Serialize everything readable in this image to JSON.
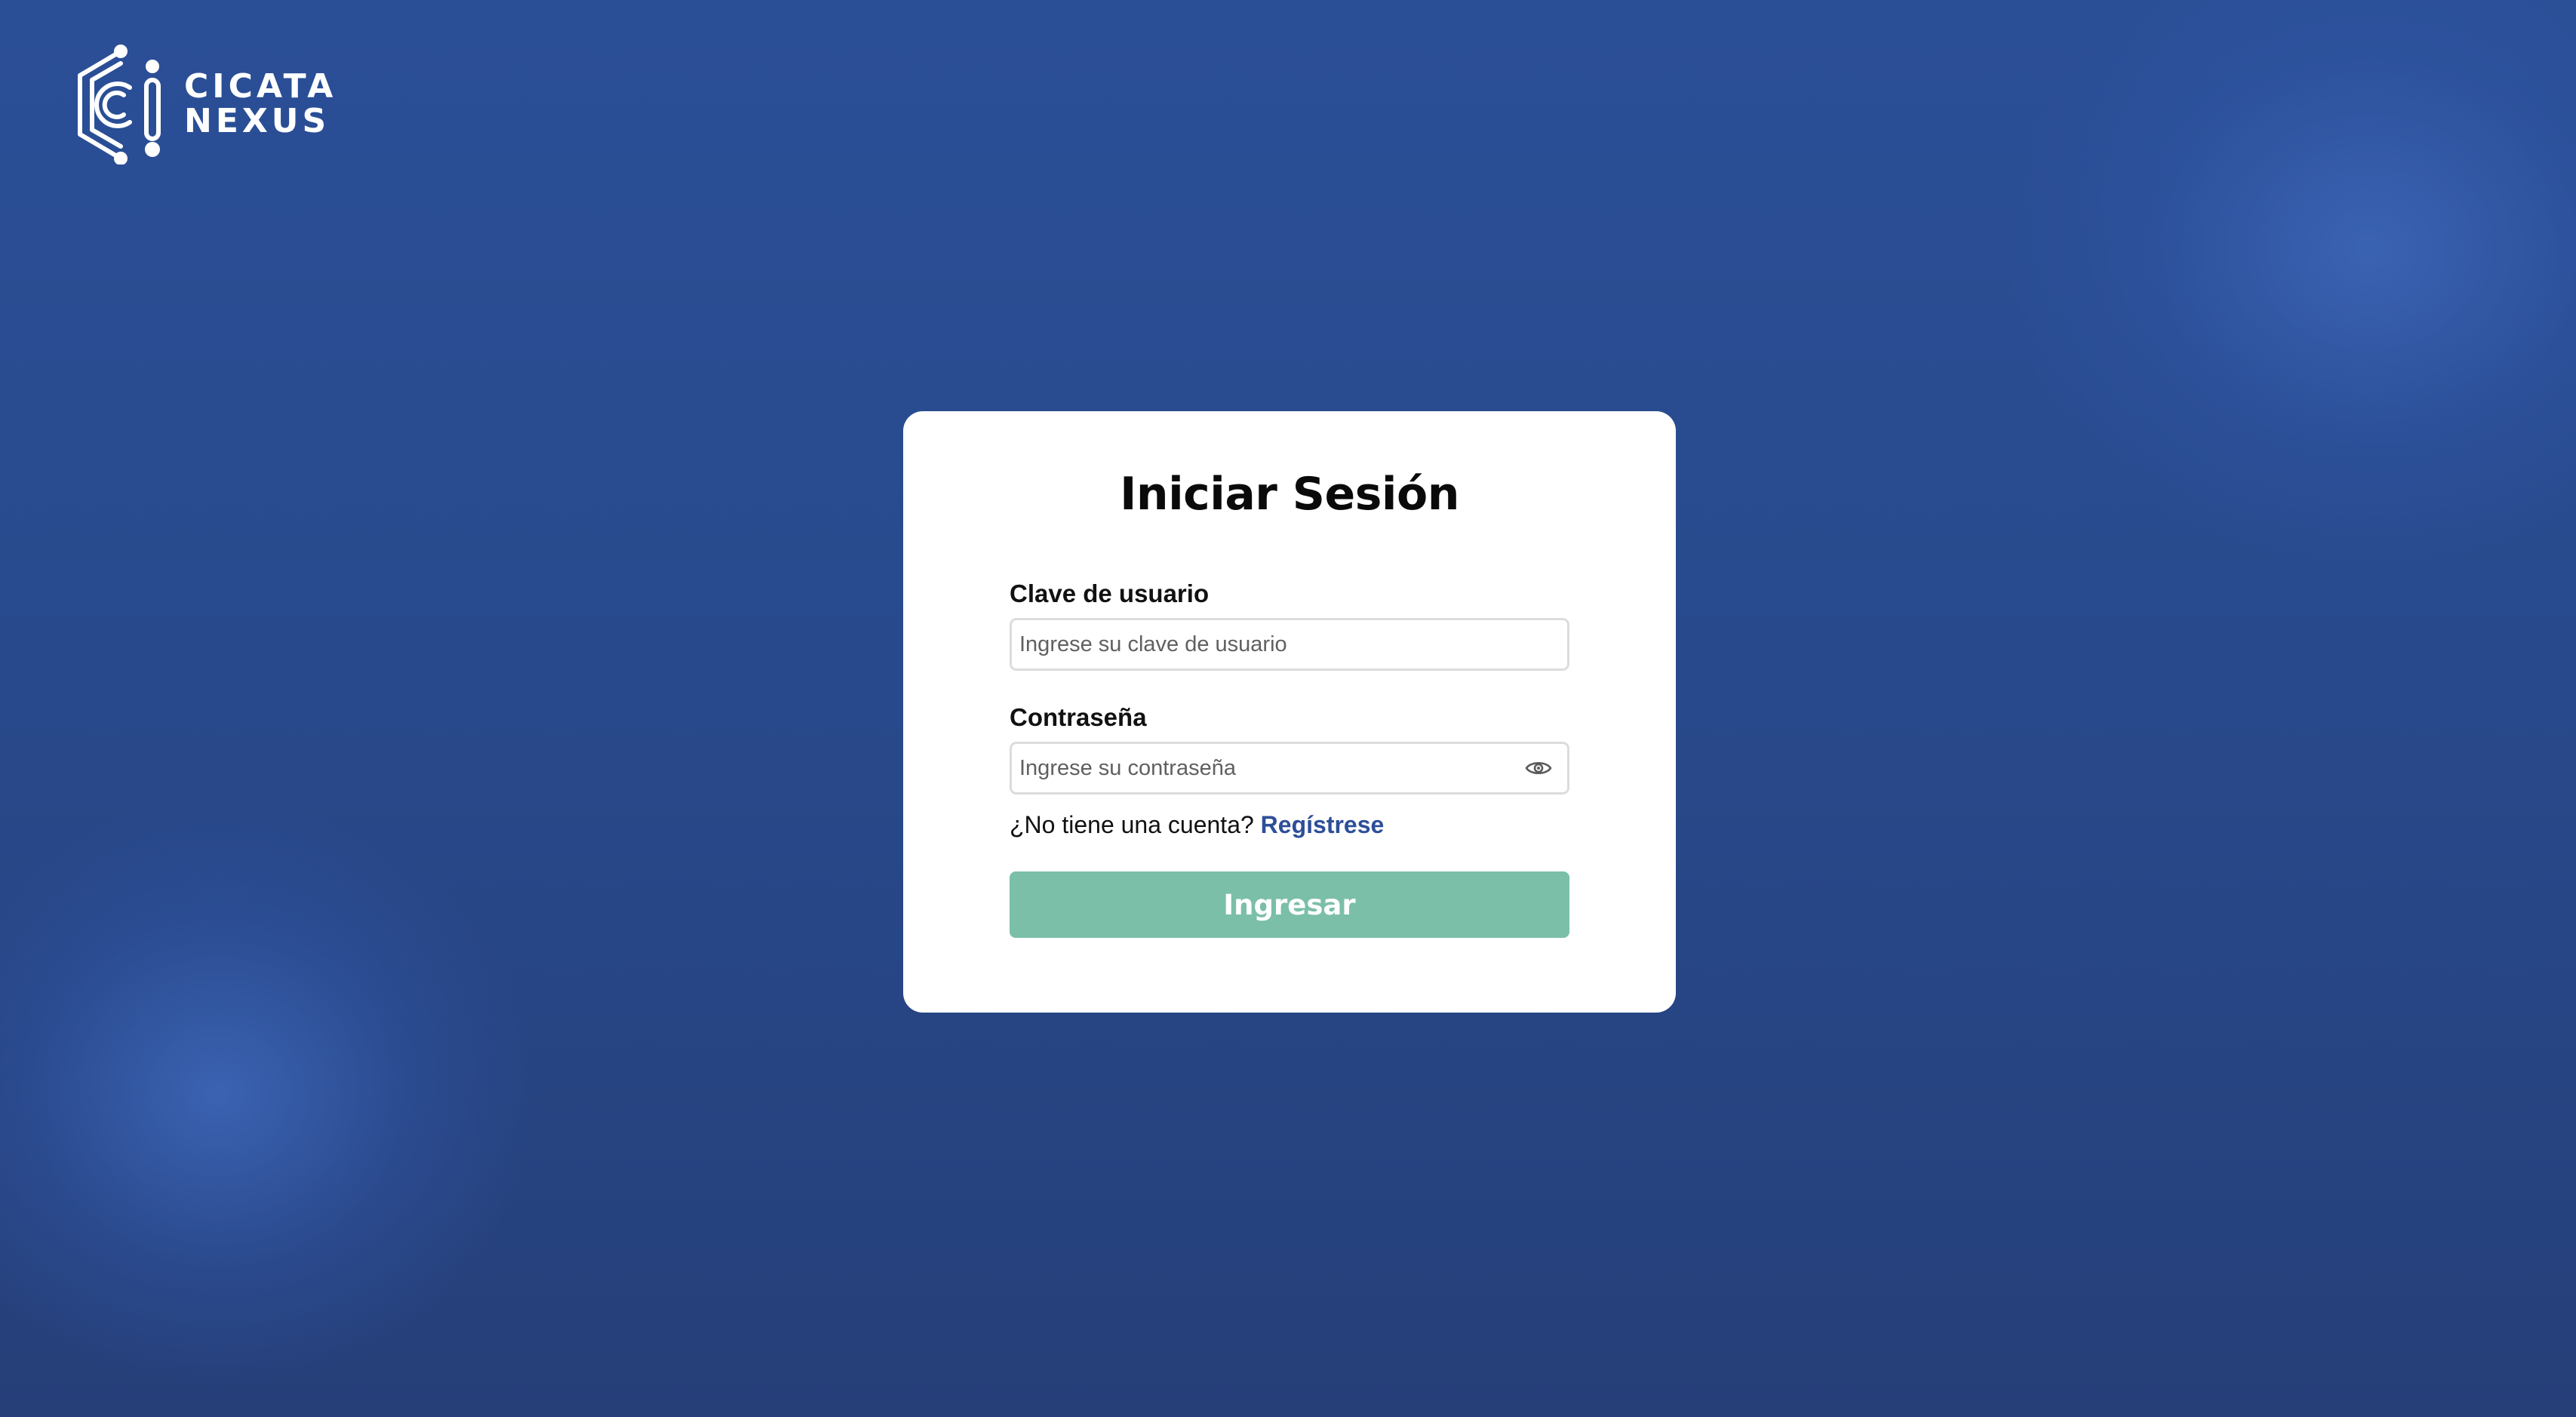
{
  "brand": {
    "line1": "CICATA",
    "line2": "NEXUS",
    "logo_icon": "circuit-hexagon-c-logo"
  },
  "login": {
    "title": "Iniciar Sesión",
    "username": {
      "label": "Clave de usuario",
      "placeholder": "Ingrese su clave de usuario",
      "value": ""
    },
    "password": {
      "label": "Contraseña",
      "placeholder": "Ingrese su contraseña",
      "value": "",
      "toggle_icon": "eye-icon"
    },
    "register_prompt": "¿No tiene una cuenta?",
    "register_link": "Regístrese",
    "submit_label": "Ingresar"
  },
  "colors": {
    "background": "#2a4b8f",
    "card": "#ffffff",
    "link": "#2d4f98",
    "button": "#7bbfa8"
  }
}
